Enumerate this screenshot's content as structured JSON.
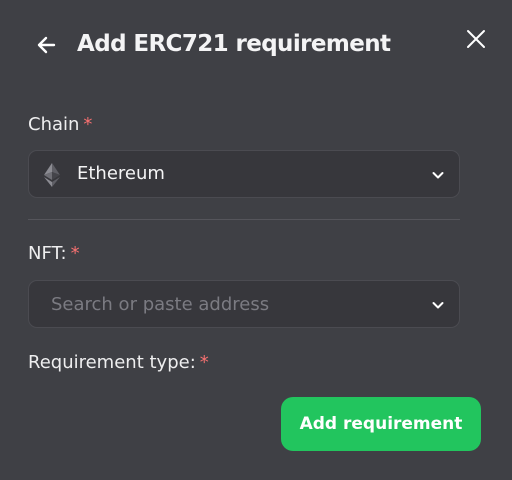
{
  "header": {
    "title": "Add ERC721 requirement",
    "back_icon": "arrow-left-icon",
    "close_icon": "close-icon"
  },
  "chain": {
    "label": "Chain",
    "required_marker": "*",
    "selected": "Ethereum",
    "selected_icon": "ethereum-icon"
  },
  "nft": {
    "label": "NFT:",
    "required_marker": "*",
    "value": "",
    "placeholder": "Search or paste address"
  },
  "requirement_type": {
    "label": "Requirement type:",
    "required_marker": "*"
  },
  "actions": {
    "submit_label": "Add requirement"
  },
  "colors": {
    "background": "#3f4045",
    "input_background": "#37373c",
    "required": "#f87171",
    "primary": "#22c55e"
  }
}
